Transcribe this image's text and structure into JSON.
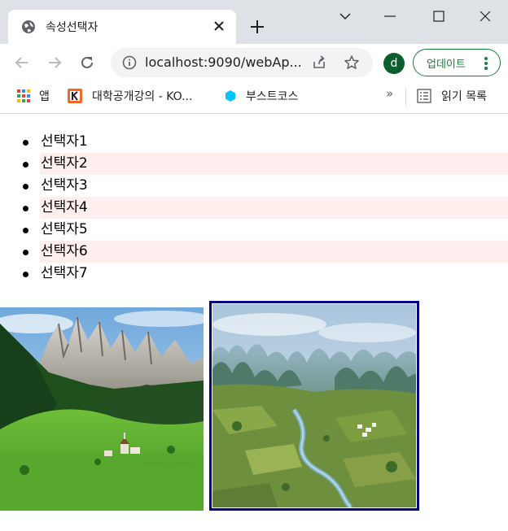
{
  "browser": {
    "tab_title": "속성선택자",
    "url": "localhost:9090/webAp...",
    "avatar_letter": "d",
    "update_label": "업데이트",
    "update_color": "#188038"
  },
  "bookmarks": [
    {
      "label": "앱",
      "icon": "apps-grid-icon"
    },
    {
      "label": "대학공개강의 - KO...",
      "icon": "kocw-icon"
    },
    {
      "label": "부스트코스",
      "icon": "boostcourse-icon"
    }
  ],
  "bookmarks_more": "»",
  "reading_list_label": "읽기 목록",
  "list_items": [
    {
      "label": "선택자1",
      "highlighted": false
    },
    {
      "label": "선택자2",
      "highlighted": true
    },
    {
      "label": "선택자3",
      "highlighted": false
    },
    {
      "label": "선택자4",
      "highlighted": true
    },
    {
      "label": "선택자5",
      "highlighted": false
    },
    {
      "label": "선택자6",
      "highlighted": true
    },
    {
      "label": "선택자7",
      "highlighted": false
    }
  ],
  "colors": {
    "highlight_row": "#ffeeee",
    "image_border": "#000080",
    "tabstrip": "#dee1e6"
  },
  "images": [
    {
      "name": "mountain-meadow-photo",
      "bordered": false
    },
    {
      "name": "karst-river-valley-photo",
      "bordered": true
    }
  ]
}
